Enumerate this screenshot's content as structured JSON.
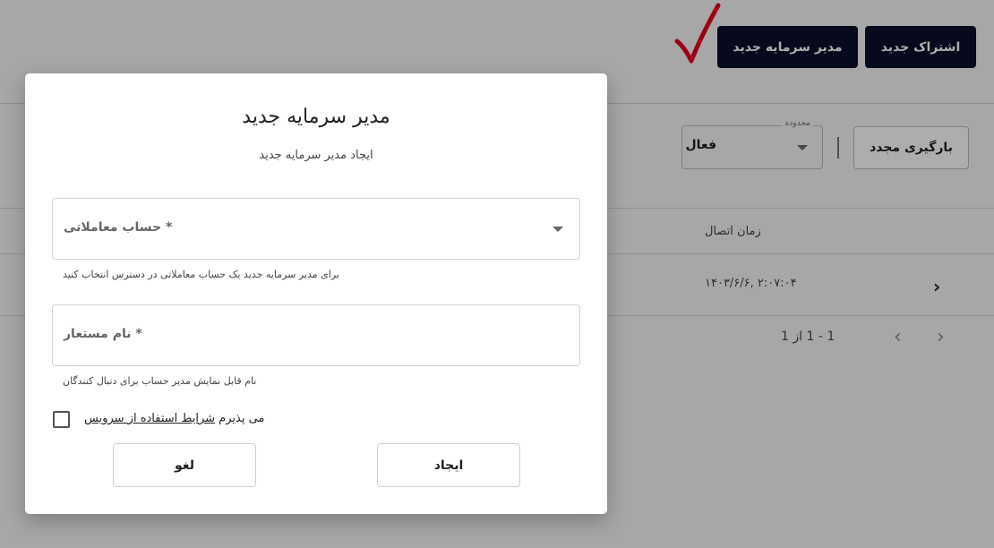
{
  "header": {
    "new_subscription_label": "اشتراک جدید",
    "new_manager_label": "مدیر سرمایه جدید"
  },
  "filters": {
    "scope_legend": "محدوده",
    "scope_value": "فعال",
    "reload_label": "بارگیری مجدد"
  },
  "table": {
    "columns": {
      "connection_time": "زمان اتصال"
    },
    "rows": [
      {
        "connection_time": "۱۴۰۳/۶/۶, ۲:۰۷:۰۴"
      }
    ]
  },
  "pagination": {
    "range_text": "1 - 1 از 1"
  },
  "dialog": {
    "title": "مدیر سرمایه جدید",
    "subtitle": "ایجاد مدیر سرمایه جدید",
    "account_field": {
      "label": "* حساب معاملاتی",
      "helper": "برای مدیر سرمایه جدید یک حساب معاملاتی در دسترس انتخاب کنید"
    },
    "alias_field": {
      "label": "* نام مستعار",
      "helper": "نام قابل نمایش مدیر حساب برای دنبال کنندگان"
    },
    "terms": {
      "prefix": "می پذیرم ",
      "link": "شرایط استفاده از سرویس",
      "checked": false
    },
    "create_label": "ایجاد",
    "cancel_label": "لغو"
  },
  "colors": {
    "primary_dark": "#0b0f2a",
    "annotation_check": "#e8001c"
  }
}
